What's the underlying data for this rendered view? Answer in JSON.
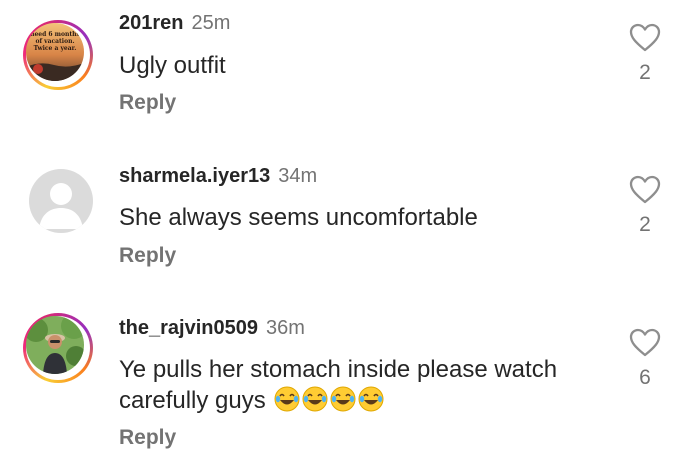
{
  "comments": [
    {
      "username": "201ren",
      "time": "25m",
      "text": "Ugly outfit",
      "reply": "Reply",
      "likes": "2",
      "avatar": {
        "type": "story-ring",
        "caption_lines": [
          "need 6 months",
          "of vacation.",
          "Twice a year."
        ]
      }
    },
    {
      "username": "sharmela.iyer13",
      "time": "34m",
      "text": "She always seems uncomfortable",
      "reply": "Reply",
      "likes": "2",
      "avatar": {
        "type": "default-silhouette"
      }
    },
    {
      "username": "the_rajvin0509",
      "time": "36m",
      "text": "Ye pulls her stomach inside please watch carefully guys",
      "emoji": [
        "😂",
        "😂",
        "😂",
        "😂"
      ],
      "reply": "Reply",
      "likes": "6",
      "avatar": {
        "type": "story-ring-photo"
      }
    }
  ],
  "icons": {
    "like": "heart-outline-icon",
    "emoji": "face-with-tears-of-joy-icon"
  },
  "colors": {
    "text": "#262626",
    "secondary": "#737373",
    "heart": "#8e8e8e"
  }
}
